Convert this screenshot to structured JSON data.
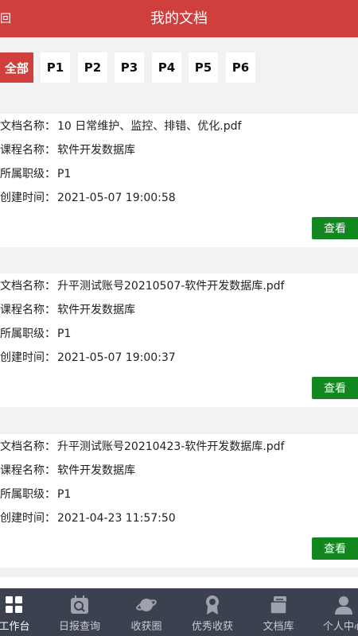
{
  "header": {
    "back_label": "回",
    "title": "我的文档"
  },
  "filters": [
    {
      "label": "全部",
      "active": true
    },
    {
      "label": "P1",
      "active": false
    },
    {
      "label": "P2",
      "active": false
    },
    {
      "label": "P3",
      "active": false
    },
    {
      "label": "P4",
      "active": false
    },
    {
      "label": "P5",
      "active": false
    },
    {
      "label": "P6",
      "active": false
    }
  ],
  "field_labels": {
    "doc_name": "文档名称：",
    "course": "课程名称：",
    "level": "所属职级：",
    "created": "创建时间："
  },
  "view_label": "查看",
  "documents": [
    {
      "doc_name": "10 日常维护、监控、排错、优化.pdf",
      "course": "软件开发数据库",
      "level": "P1",
      "created": "2021-05-07 19:00:58"
    },
    {
      "doc_name": "升平测试账号20210507-软件开发数据库.pdf",
      "course": "软件开发数据库",
      "level": "P1",
      "created": "2021-05-07 19:00:37"
    },
    {
      "doc_name": "升平测试账号20210423-软件开发数据库.pdf",
      "course": "软件开发数据库",
      "level": "P1",
      "created": "2021-04-23 11:57:50"
    }
  ],
  "tabbar": [
    {
      "label": "工作台",
      "icon": "grid-icon",
      "active": true
    },
    {
      "label": "日报查询",
      "icon": "report-search-icon",
      "active": false
    },
    {
      "label": "收获圈",
      "icon": "planet-icon",
      "active": false
    },
    {
      "label": "优秀收获",
      "icon": "medal-icon",
      "active": false
    },
    {
      "label": "文档库",
      "icon": "document-library-icon",
      "active": false
    },
    {
      "label": "个人中心",
      "icon": "user-icon",
      "active": false
    }
  ],
  "colors": {
    "brand_red": "#cf3f3d",
    "view_green": "#13871f",
    "tabbar_bg": "#3c4150"
  }
}
